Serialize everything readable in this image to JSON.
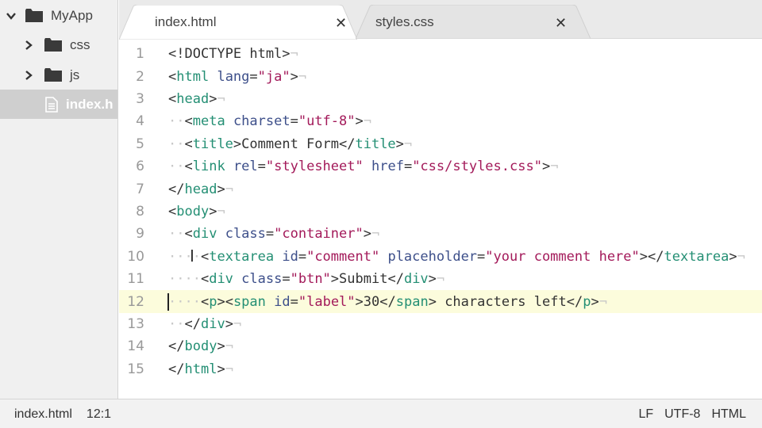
{
  "sidebar": {
    "root": {
      "label": "MyApp",
      "icon": "folder-icon"
    },
    "items": [
      {
        "label": "css",
        "icon": "folder-icon"
      },
      {
        "label": "js",
        "icon": "folder-icon"
      },
      {
        "label": "index.h",
        "icon": "file-icon",
        "selected": true
      }
    ]
  },
  "tabs": [
    {
      "label": "index.html",
      "active": true,
      "close": "✕"
    },
    {
      "label": "styles.css",
      "active": false,
      "close": "✕"
    }
  ],
  "editor": {
    "current_line": 12,
    "lines": [
      {
        "n": "1",
        "indent": "",
        "tokens": [
          [
            "p",
            "<!DOCTYPE html>"
          ]
        ]
      },
      {
        "n": "2",
        "indent": "",
        "tokens": [
          [
            "p",
            "<"
          ],
          [
            "t",
            "html"
          ],
          [
            "p",
            " "
          ],
          [
            "a",
            "lang"
          ],
          [
            "p",
            "="
          ],
          [
            "s",
            "\"ja\""
          ],
          [
            "p",
            ">"
          ]
        ]
      },
      {
        "n": "3",
        "indent": "",
        "tokens": [
          [
            "p",
            "<"
          ],
          [
            "t",
            "head"
          ],
          [
            "p",
            ">"
          ]
        ]
      },
      {
        "n": "4",
        "indent": "··",
        "tokens": [
          [
            "p",
            "<"
          ],
          [
            "t",
            "meta"
          ],
          [
            "p",
            " "
          ],
          [
            "a",
            "charset"
          ],
          [
            "p",
            "="
          ],
          [
            "s",
            "\"utf-8\""
          ],
          [
            "p",
            ">"
          ]
        ]
      },
      {
        "n": "5",
        "indent": "··",
        "tokens": [
          [
            "p",
            "<"
          ],
          [
            "t",
            "title"
          ],
          [
            "p",
            ">"
          ],
          [
            "x",
            "Comment Form"
          ],
          [
            "p",
            "</"
          ],
          [
            "t",
            "title"
          ],
          [
            "p",
            ">"
          ]
        ]
      },
      {
        "n": "6",
        "indent": "··",
        "tokens": [
          [
            "p",
            "<"
          ],
          [
            "t",
            "link"
          ],
          [
            "p",
            " "
          ],
          [
            "a",
            "rel"
          ],
          [
            "p",
            "="
          ],
          [
            "s",
            "\"stylesheet\""
          ],
          [
            "p",
            " "
          ],
          [
            "a",
            "href"
          ],
          [
            "p",
            "="
          ],
          [
            "s",
            "\"css/styles.css\""
          ],
          [
            "p",
            ">"
          ]
        ]
      },
      {
        "n": "7",
        "indent": "",
        "tokens": [
          [
            "p",
            "</"
          ],
          [
            "t",
            "head"
          ],
          [
            "p",
            ">"
          ]
        ]
      },
      {
        "n": "8",
        "indent": "",
        "tokens": [
          [
            "p",
            "<"
          ],
          [
            "t",
            "body"
          ],
          [
            "p",
            ">"
          ]
        ]
      },
      {
        "n": "9",
        "indent": "··",
        "tokens": [
          [
            "p",
            "<"
          ],
          [
            "t",
            "div"
          ],
          [
            "p",
            " "
          ],
          [
            "a",
            "class"
          ],
          [
            "p",
            "="
          ],
          [
            "s",
            "\"container\""
          ],
          [
            "p",
            ">"
          ]
        ]
      },
      {
        "n": "10",
        "indent": "····",
        "tokens": [
          [
            "p",
            "<"
          ],
          [
            "t",
            "textarea"
          ],
          [
            "p",
            " "
          ],
          [
            "a",
            "id"
          ],
          [
            "p",
            "="
          ],
          [
            "s",
            "\"comment\""
          ],
          [
            "p",
            " "
          ],
          [
            "a",
            "placeholder"
          ],
          [
            "p",
            "="
          ],
          [
            "s",
            "\"your comment here\""
          ],
          [
            "p",
            "></"
          ],
          [
            "t",
            "textarea"
          ],
          [
            "p",
            ">"
          ]
        ]
      },
      {
        "n": "11",
        "indent": "····",
        "tokens": [
          [
            "p",
            "<"
          ],
          [
            "t",
            "div"
          ],
          [
            "p",
            " "
          ],
          [
            "a",
            "class"
          ],
          [
            "p",
            "="
          ],
          [
            "s",
            "\"btn\""
          ],
          [
            "p",
            ">"
          ],
          [
            "x",
            "Submit"
          ],
          [
            "p",
            "</"
          ],
          [
            "t",
            "div"
          ],
          [
            "p",
            ">"
          ]
        ]
      },
      {
        "n": "12",
        "indent": "····",
        "tokens": [
          [
            "p",
            "<"
          ],
          [
            "t",
            "p"
          ],
          [
            "p",
            "><"
          ],
          [
            "t",
            "span"
          ],
          [
            "p",
            " "
          ],
          [
            "a",
            "id"
          ],
          [
            "p",
            "="
          ],
          [
            "s",
            "\"label\""
          ],
          [
            "p",
            ">"
          ],
          [
            "x",
            "30"
          ],
          [
            "p",
            "</"
          ],
          [
            "t",
            "span"
          ],
          [
            "p",
            ">"
          ],
          [
            "x",
            " characters left"
          ],
          [
            "p",
            "</"
          ],
          [
            "t",
            "p"
          ],
          [
            "p",
            ">"
          ]
        ]
      },
      {
        "n": "13",
        "indent": "··",
        "tokens": [
          [
            "p",
            "</"
          ],
          [
            "t",
            "div"
          ],
          [
            "p",
            ">"
          ]
        ]
      },
      {
        "n": "14",
        "indent": "",
        "tokens": [
          [
            "p",
            "</"
          ],
          [
            "t",
            "body"
          ],
          [
            "p",
            ">"
          ]
        ]
      },
      {
        "n": "15",
        "indent": "",
        "tokens": [
          [
            "p",
            "</"
          ],
          [
            "t",
            "html"
          ],
          [
            "p",
            ">"
          ]
        ]
      }
    ],
    "eol_marker": "¬"
  },
  "statusbar": {
    "file": "index.html",
    "position": "12:1",
    "line_ending": "LF",
    "encoding": "UTF-8",
    "grammar": "HTML"
  },
  "colors": {
    "tag": "#248f74",
    "attribute": "#3d4f8a",
    "string": "#a31a5a",
    "current_line": "#fcfcdc"
  }
}
